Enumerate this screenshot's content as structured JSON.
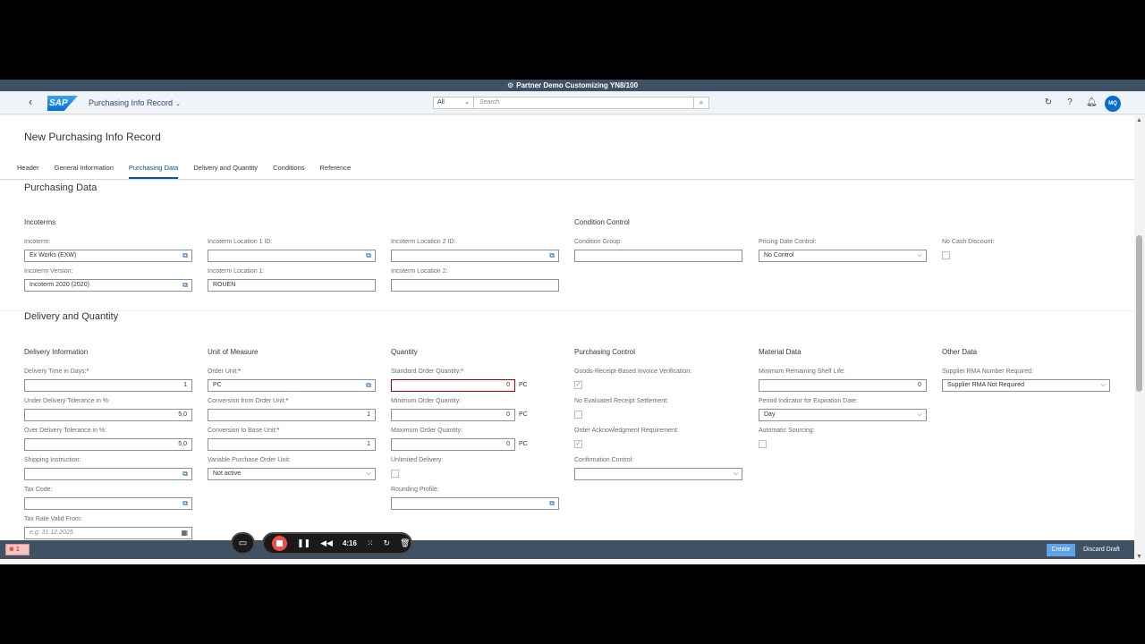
{
  "window": {
    "title": "Partner Demo Customizing YN8/100"
  },
  "shell": {
    "app_title": "Purchasing Info Record",
    "search_scope": "All",
    "search_placeholder": "Search",
    "avatar_initials": "MQ",
    "logo_text": "SAP"
  },
  "header": {
    "title": "New Purchasing Info Record"
  },
  "tabs": [
    {
      "label": "Header",
      "active": false
    },
    {
      "label": "General Information",
      "active": false
    },
    {
      "label": "Purchasing Data",
      "active": true
    },
    {
      "label": "Delivery and Quantity",
      "active": false
    },
    {
      "label": "Conditions",
      "active": false
    },
    {
      "label": "Reference",
      "active": false
    }
  ],
  "purchasing": {
    "section_title": "Purchasing Data",
    "incoterms": {
      "title": "Incoterms",
      "incoterm_label": "Incoterm:",
      "incoterm_value": "Ex Works (EXW)",
      "version_label": "Incoterm Version:",
      "version_value": "Incoterm 2020 (2020)",
      "loc1id_label": "Incoterm Location 1 ID:",
      "loc1id_value": "",
      "loc1_label": "Incoterm Location 1:",
      "loc1_value": "ROUEN",
      "loc2id_label": "Incoterm Location 2 ID:",
      "loc2id_value": "",
      "loc2_label": "Incoterm Location 2:",
      "loc2_value": ""
    },
    "condition_control": {
      "title": "Condition Control",
      "group_label": "Condition Group:",
      "group_value": "",
      "pricing_label": "Pricing Date Control:",
      "pricing_value": "No Control",
      "cash_label": "No Cash Discount:",
      "cash_checked": false
    }
  },
  "delivery": {
    "section_title": "Delivery and Quantity",
    "info": {
      "title": "Delivery Information",
      "days_label": "Delivery Time in Days:",
      "days_value": "1",
      "under_label": "Under Delivery Tolerance in %:",
      "under_value": "5,0",
      "over_label": "Over Delivery Tolerance in %:",
      "over_value": "5,0",
      "shipping_label": "Shipping Instruction:",
      "shipping_value": "",
      "tax_label": "Tax Code:",
      "tax_value": "",
      "taxdate_label": "Tax Rate Valid From:",
      "taxdate_placeholder": "e.g. 31.12.2025"
    },
    "uom": {
      "title": "Unit of Measure",
      "order_unit_label": "Order Unit:",
      "order_unit_value": "PC",
      "conv_from_label": "Conversion from Order Unit:",
      "conv_from_value": "1",
      "conv_to_label": "Conversion to Base Unit:",
      "conv_to_value": "1",
      "variable_label": "Variable Purchase Order Unit:",
      "variable_value": "Not active"
    },
    "quantity": {
      "title": "Quantity",
      "std_label": "Standard Order Quantity:",
      "std_value": "0",
      "std_unit": "PC",
      "min_label": "Minimum Order Quantity:",
      "min_value": "0",
      "min_unit": "PC",
      "max_label": "Maximum Order Quantity:",
      "max_value": "0",
      "max_unit": "PC",
      "unlimited_label": "Unlimited Delivery:",
      "rounding_label": "Rounding Profile:",
      "rounding_value": ""
    },
    "control": {
      "title": "Purchasing Control",
      "gr_label": "Goods-Receipt-Based Invoice Verification:",
      "ers_label": "No Evaluated Receipt Settlement:",
      "ack_label": "Order Acknowledgment Requirement:",
      "confirm_label": "Confirmation Control:",
      "confirm_value": ""
    },
    "material": {
      "title": "Material Data",
      "shelf_label": "Minimum Remaining Shelf Life:",
      "shelf_value": "0",
      "period_label": "Period Indicator for Expiration Date:",
      "period_value": "Day",
      "sourcing_label": "Automatic Sourcing:"
    },
    "other": {
      "title": "Other Data",
      "rma_label": "Supplier RMA Number Required:",
      "rma_value": "Supplier RMA Not Required"
    }
  },
  "footer": {
    "message_count": "1",
    "create_label": "Create",
    "discard_label": "Discard Draft"
  },
  "recorder": {
    "time": "4:16"
  }
}
